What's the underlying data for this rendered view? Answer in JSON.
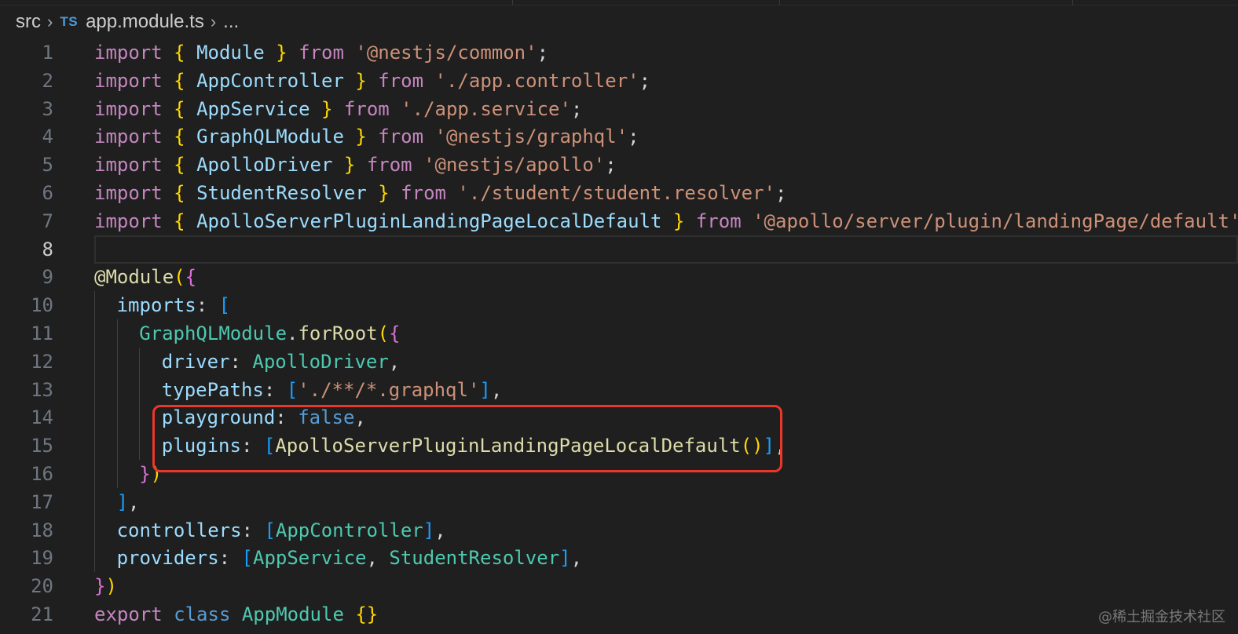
{
  "breadcrumb": {
    "folder": "src",
    "file_icon": "TS",
    "file": "app.module.ts",
    "trail": "..."
  },
  "code_lines": [
    {
      "n": "1",
      "indent": 0,
      "tokens": [
        [
          "kw",
          "import"
        ],
        [
          "pun",
          " "
        ],
        [
          "br1",
          "{"
        ],
        [
          "pun",
          " "
        ],
        [
          "id",
          "Module"
        ],
        [
          "pun",
          " "
        ],
        [
          "br1",
          "}"
        ],
        [
          "pun",
          " "
        ],
        [
          "kw",
          "from"
        ],
        [
          "pun",
          " "
        ],
        [
          "str",
          "'@nestjs/common'"
        ],
        [
          "pun",
          ";"
        ]
      ]
    },
    {
      "n": "2",
      "indent": 0,
      "tokens": [
        [
          "kw",
          "import"
        ],
        [
          "pun",
          " "
        ],
        [
          "br1",
          "{"
        ],
        [
          "pun",
          " "
        ],
        [
          "id",
          "AppController"
        ],
        [
          "pun",
          " "
        ],
        [
          "br1",
          "}"
        ],
        [
          "pun",
          " "
        ],
        [
          "kw",
          "from"
        ],
        [
          "pun",
          " "
        ],
        [
          "str",
          "'./app.controller'"
        ],
        [
          "pun",
          ";"
        ]
      ]
    },
    {
      "n": "3",
      "indent": 0,
      "tokens": [
        [
          "kw",
          "import"
        ],
        [
          "pun",
          " "
        ],
        [
          "br1",
          "{"
        ],
        [
          "pun",
          " "
        ],
        [
          "id",
          "AppService"
        ],
        [
          "pun",
          " "
        ],
        [
          "br1",
          "}"
        ],
        [
          "pun",
          " "
        ],
        [
          "kw",
          "from"
        ],
        [
          "pun",
          " "
        ],
        [
          "str",
          "'./app.service'"
        ],
        [
          "pun",
          ";"
        ]
      ]
    },
    {
      "n": "4",
      "indent": 0,
      "tokens": [
        [
          "kw",
          "import"
        ],
        [
          "pun",
          " "
        ],
        [
          "br1",
          "{"
        ],
        [
          "pun",
          " "
        ],
        [
          "id",
          "GraphQLModule"
        ],
        [
          "pun",
          " "
        ],
        [
          "br1",
          "}"
        ],
        [
          "pun",
          " "
        ],
        [
          "kw",
          "from"
        ],
        [
          "pun",
          " "
        ],
        [
          "str",
          "'@nestjs/graphql'"
        ],
        [
          "pun",
          ";"
        ]
      ]
    },
    {
      "n": "5",
      "indent": 0,
      "tokens": [
        [
          "kw",
          "import"
        ],
        [
          "pun",
          " "
        ],
        [
          "br1",
          "{"
        ],
        [
          "pun",
          " "
        ],
        [
          "id",
          "ApolloDriver"
        ],
        [
          "pun",
          " "
        ],
        [
          "br1",
          "}"
        ],
        [
          "pun",
          " "
        ],
        [
          "kw",
          "from"
        ],
        [
          "pun",
          " "
        ],
        [
          "str",
          "'@nestjs/apollo'"
        ],
        [
          "pun",
          ";"
        ]
      ]
    },
    {
      "n": "6",
      "indent": 0,
      "tokens": [
        [
          "kw",
          "import"
        ],
        [
          "pun",
          " "
        ],
        [
          "br1",
          "{"
        ],
        [
          "pun",
          " "
        ],
        [
          "id",
          "StudentResolver"
        ],
        [
          "pun",
          " "
        ],
        [
          "br1",
          "}"
        ],
        [
          "pun",
          " "
        ],
        [
          "kw",
          "from"
        ],
        [
          "pun",
          " "
        ],
        [
          "str",
          "'./student/student.resolver'"
        ],
        [
          "pun",
          ";"
        ]
      ]
    },
    {
      "n": "7",
      "indent": 0,
      "tokens": [
        [
          "kw",
          "import"
        ],
        [
          "pun",
          " "
        ],
        [
          "br1",
          "{"
        ],
        [
          "pun",
          " "
        ],
        [
          "id",
          "ApolloServerPluginLandingPageLocalDefault"
        ],
        [
          "pun",
          " "
        ],
        [
          "br1",
          "}"
        ],
        [
          "pun",
          " "
        ],
        [
          "kw",
          "from"
        ],
        [
          "pun",
          " "
        ],
        [
          "str",
          "'@apollo/server/plugin/landingPage/default'"
        ]
      ]
    },
    {
      "n": "8",
      "indent": 0,
      "current": true,
      "tokens": []
    },
    {
      "n": "9",
      "indent": 0,
      "tokens": [
        [
          "dec",
          "@Module"
        ],
        [
          "br1",
          "("
        ],
        [
          "br2",
          "{"
        ]
      ]
    },
    {
      "n": "10",
      "indent": 1,
      "tokens": [
        [
          "id",
          "imports"
        ],
        [
          "pun",
          ": "
        ],
        [
          "br3",
          "["
        ]
      ]
    },
    {
      "n": "11",
      "indent": 2,
      "tokens": [
        [
          "cls",
          "GraphQLModule"
        ],
        [
          "pun",
          "."
        ],
        [
          "fn",
          "forRoot"
        ],
        [
          "br1",
          "("
        ],
        [
          "br2",
          "{"
        ]
      ]
    },
    {
      "n": "12",
      "indent": 3,
      "tokens": [
        [
          "id",
          "driver"
        ],
        [
          "pun",
          ": "
        ],
        [
          "cls",
          "ApolloDriver"
        ],
        [
          "pun",
          ","
        ]
      ]
    },
    {
      "n": "13",
      "indent": 3,
      "tokens": [
        [
          "id",
          "typePaths"
        ],
        [
          "pun",
          ": "
        ],
        [
          "br3",
          "["
        ],
        [
          "str",
          "'./**/*.graphql'"
        ],
        [
          "br3",
          "]"
        ],
        [
          "pun",
          ","
        ]
      ]
    },
    {
      "n": "14",
      "indent": 3,
      "tokens": [
        [
          "id",
          "playground"
        ],
        [
          "pun",
          ": "
        ],
        [
          "kw2",
          "false"
        ],
        [
          "pun",
          ","
        ]
      ]
    },
    {
      "n": "15",
      "indent": 3,
      "tokens": [
        [
          "id",
          "plugins"
        ],
        [
          "pun",
          ": "
        ],
        [
          "br3",
          "["
        ],
        [
          "fn",
          "ApolloServerPluginLandingPageLocalDefault"
        ],
        [
          "br1",
          "()"
        ],
        [
          "br3",
          "]"
        ],
        [
          "pun",
          ","
        ]
      ]
    },
    {
      "n": "16",
      "indent": 2,
      "tokens": [
        [
          "br2",
          "}"
        ],
        [
          "br1",
          ")"
        ]
      ]
    },
    {
      "n": "17",
      "indent": 1,
      "tokens": [
        [
          "br3",
          "]"
        ],
        [
          "pun",
          ","
        ]
      ]
    },
    {
      "n": "18",
      "indent": 1,
      "tokens": [
        [
          "id",
          "controllers"
        ],
        [
          "pun",
          ": "
        ],
        [
          "br3",
          "["
        ],
        [
          "cls",
          "AppController"
        ],
        [
          "br3",
          "]"
        ],
        [
          "pun",
          ","
        ]
      ]
    },
    {
      "n": "19",
      "indent": 1,
      "tokens": [
        [
          "id",
          "providers"
        ],
        [
          "pun",
          ": "
        ],
        [
          "br3",
          "["
        ],
        [
          "cls",
          "AppService"
        ],
        [
          "pun",
          ", "
        ],
        [
          "cls",
          "StudentResolver"
        ],
        [
          "br3",
          "]"
        ],
        [
          "pun",
          ","
        ]
      ]
    },
    {
      "n": "20",
      "indent": 0,
      "tokens": [
        [
          "br2",
          "}"
        ],
        [
          "br1",
          ")"
        ]
      ]
    },
    {
      "n": "21",
      "indent": 0,
      "tokens": [
        [
          "kw",
          "export"
        ],
        [
          "pun",
          " "
        ],
        [
          "kw2",
          "class"
        ],
        [
          "pun",
          " "
        ],
        [
          "cls",
          "AppModule"
        ],
        [
          "pun",
          " "
        ],
        [
          "br1",
          "{}"
        ]
      ]
    }
  ],
  "watermark": "@稀土掘金技术社区",
  "colors": {
    "background": "#1f1f1f",
    "highlight_box": "#e8382a"
  }
}
